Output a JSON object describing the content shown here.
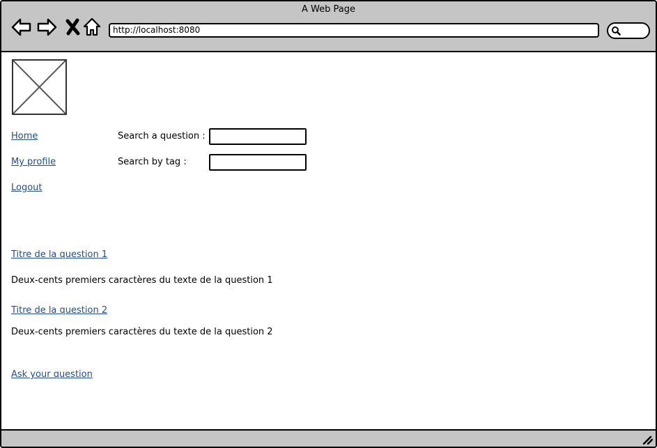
{
  "window": {
    "title": "A Web Page"
  },
  "browser": {
    "url": "http://localhost:8080",
    "icons": [
      "back-arrow-icon",
      "forward-arrow-icon",
      "close-x-icon",
      "home-icon",
      "search-icon"
    ]
  },
  "nav": {
    "home": "Home",
    "profile": "My profile",
    "logout": "Logout"
  },
  "search": {
    "question_label": "Search a question :",
    "question_value": "",
    "tag_label": "Search by tag :",
    "tag_value": ""
  },
  "questions": [
    {
      "title": "Titre de la question 1",
      "excerpt": "Deux-cents premiers caractères du texte de la question 1"
    },
    {
      "title": "Titre de la question 2",
      "excerpt": "Deux-cents premiers caractères du texte de la question 2"
    }
  ],
  "actions": {
    "ask": "Ask your question"
  },
  "colors": {
    "chrome": "#c5c5c5",
    "link": "#1f4e8c",
    "border": "#000000"
  }
}
